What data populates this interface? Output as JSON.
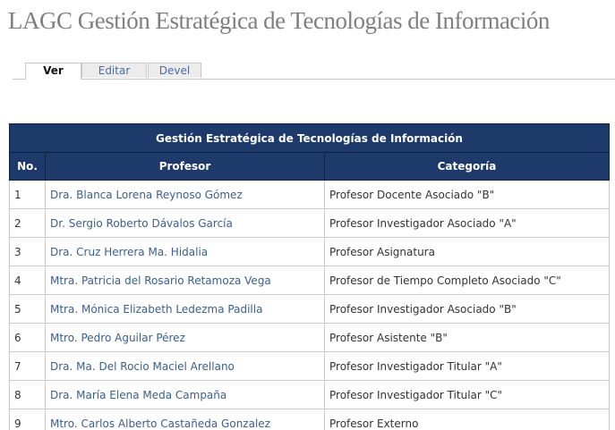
{
  "site": {
    "title": "LAGC Gestión Estratégica de Tecnologías de Información"
  },
  "tabs": [
    {
      "label": "Ver",
      "active": true
    },
    {
      "label": "Editar",
      "active": false
    },
    {
      "label": "Devel",
      "active": false
    }
  ],
  "table": {
    "caption": "Gestión Estratégica de Tecnologías de Información",
    "headers": {
      "no": "No.",
      "profesor": "Profesor",
      "categoria": "Categoría"
    },
    "rows": [
      {
        "no": "1",
        "profesor": "Dra. Blanca Lorena Reynoso Gómez",
        "categoria": "Profesor Docente Asociado \"B\""
      },
      {
        "no": "2",
        "profesor": "Dr. Sergio Roberto Dávalos García",
        "categoria": "Profesor Investigador Asociado \"A\""
      },
      {
        "no": "3",
        "profesor": "Dra. Cruz Herrera Ma. Hidalia",
        "categoria": "Profesor Asignatura"
      },
      {
        "no": "4",
        "profesor": "Mtra. Patricia del Rosario Retamoza Vega",
        "categoria": "Profesor de Tiempo Completo Asociado \"C\""
      },
      {
        "no": "5",
        "profesor": "Mtra. Mónica Elizabeth Ledezma Padilla",
        "categoria": "Profesor Investigador Asociado \"B\""
      },
      {
        "no": "6",
        "profesor": "Mtro. Pedro Aguilar Pérez",
        "categoria": "Profesor Asistente \"B\""
      },
      {
        "no": "7",
        "profesor": "Dra. Ma. Del Rocio Maciel Arellano",
        "categoria": "Profesor Investigador Titular \"A\""
      },
      {
        "no": "8",
        "profesor": "Dra. María Elena Meda Campaña",
        "categoria": "Profesor Investigador Titular \"C\""
      },
      {
        "no": "9",
        "profesor": "Mtro. Carlos Alberto Castañeda Gonzalez",
        "categoria": "Profesor Externo"
      }
    ]
  },
  "colors": {
    "header_bg": "#1d3a6a",
    "link": "#3a5f8f",
    "title": "#7f7f7f"
  }
}
